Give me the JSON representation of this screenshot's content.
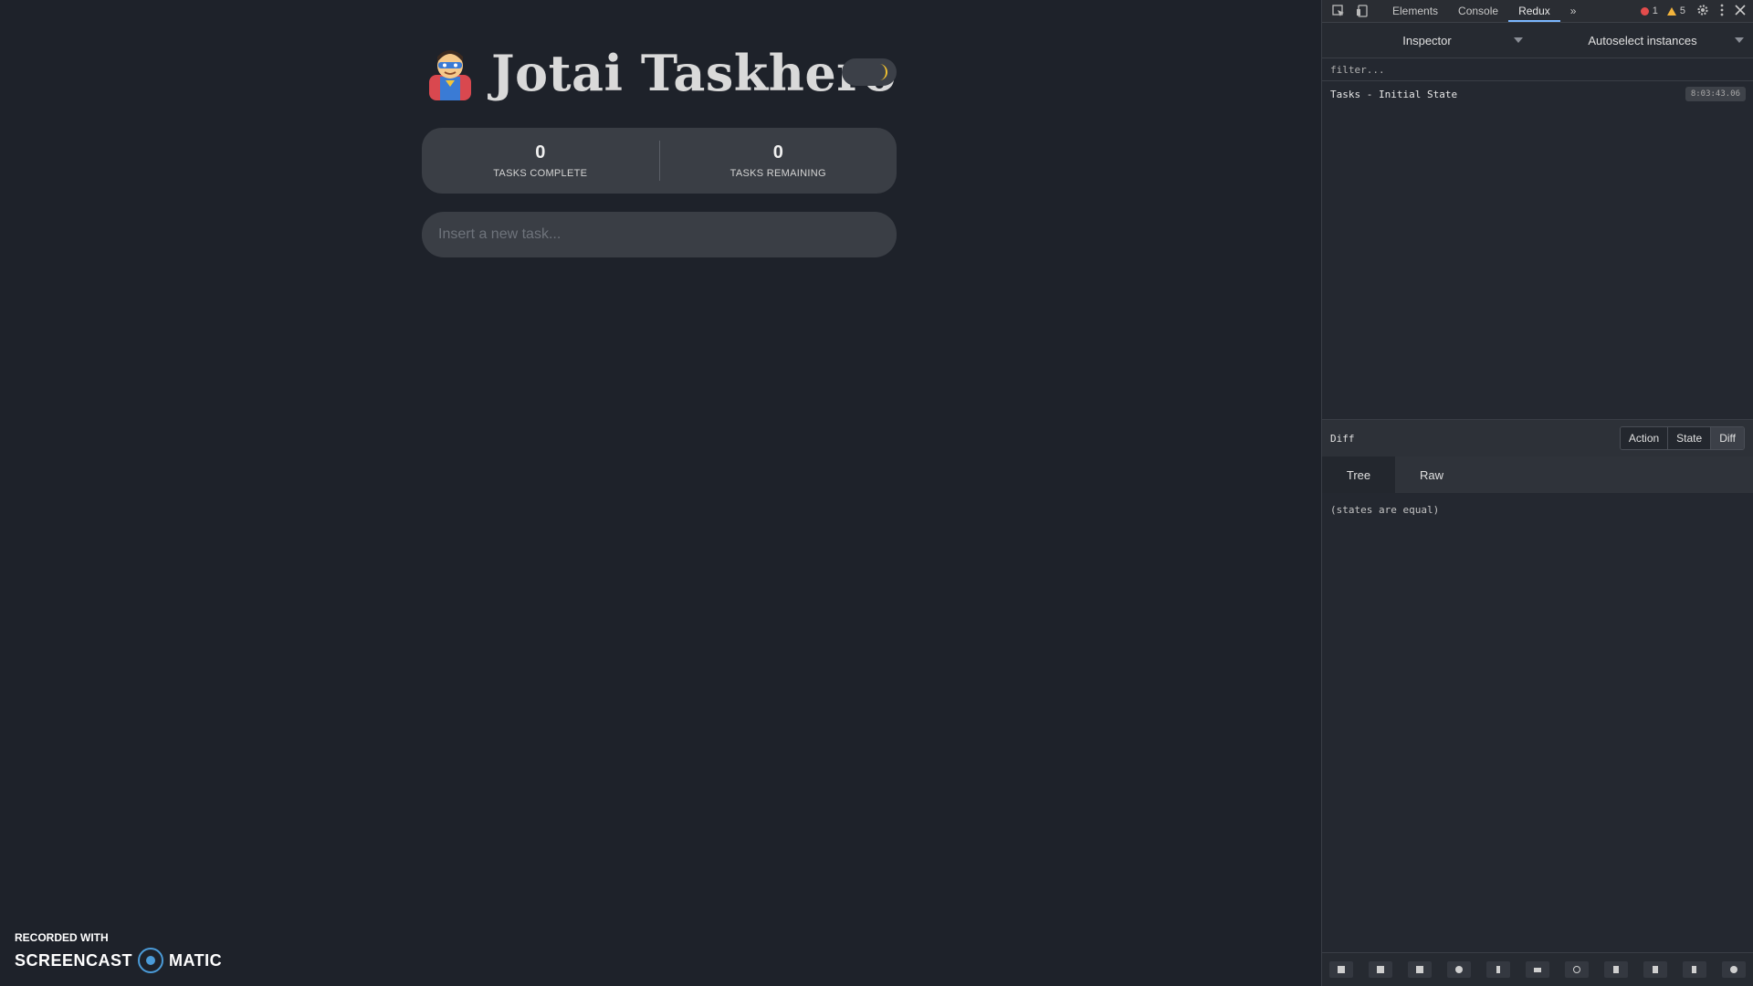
{
  "app": {
    "title": "Jotai Taskhero",
    "stats": [
      {
        "value": "0",
        "label": "TASKS COMPLETE"
      },
      {
        "value": "0",
        "label": "TASKS REMAINING"
      }
    ],
    "input": {
      "placeholder": "Insert a new task...",
      "value": ""
    },
    "theme_toggle_icon": "moon-icon",
    "hero_icon": "superhero-icon"
  },
  "watermark": {
    "top": "RECORDED WITH",
    "left": "SCREENCAST",
    "right": "MATIC"
  },
  "devtools": {
    "tabs": [
      "Elements",
      "Console",
      "Redux"
    ],
    "active_tab": "Redux",
    "errors": "1",
    "warnings": "5",
    "inspector_label": "Inspector",
    "instances_label": "Autoselect instances",
    "filter_placeholder": "filter...",
    "actions": [
      {
        "name": "Tasks - Initial State",
        "time": "8:03:43.06"
      }
    ],
    "diff_label": "Diff",
    "mode_buttons": [
      "Action",
      "State",
      "Diff"
    ],
    "active_mode": "Diff",
    "subtabs": [
      "Tree",
      "Raw"
    ],
    "active_subtab": "Tree",
    "diff_message": "(states are equal)",
    "footer_icons": [
      "log-monitor-icon",
      "chart-icon",
      "inspector-icon",
      "record-icon",
      "pin-icon",
      "keyboard-icon",
      "timer-icon",
      "upload-icon",
      "download-icon",
      "remote-icon",
      "settings-icon"
    ]
  },
  "colors": {
    "accent_blue": "#7ab7ff",
    "moon": "#f2c230",
    "error": "#e34c4c",
    "warning": "#f3b43c"
  }
}
